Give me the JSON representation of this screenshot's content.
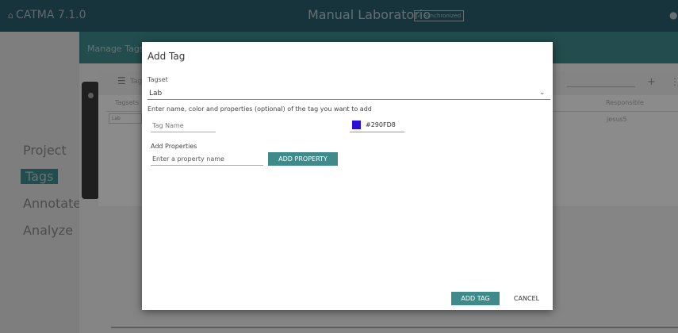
{
  "app": {
    "name": "CATMA 7.1.0",
    "logo_icon": "home-icon"
  },
  "document": {
    "title": "Manual Laboratorio",
    "sync_status": "Synchronized"
  },
  "sidebar": {
    "items": [
      {
        "label": "Project",
        "active": false
      },
      {
        "label": "Tags",
        "active": true
      },
      {
        "label": "Annotate",
        "active": false
      },
      {
        "label": "Analyze",
        "active": false
      }
    ]
  },
  "manage": {
    "title": "Manage Tags",
    "tab_label": "Tags",
    "columns": {
      "tagsets": "Tagsets",
      "responsible": "Responsible"
    },
    "rows": [
      {
        "tagset": "Lab",
        "responsible": "jesus5"
      }
    ]
  },
  "dialog": {
    "title": "Add Tag",
    "tagset_label": "Tagset",
    "tagset_value": "Lab",
    "instructions": "Enter name, color and properties (optional) of the tag you want to add",
    "tag_name_placeholder": "Tag Name",
    "color_hex": "#290FD8",
    "color_value": "#290FD8",
    "properties_label": "Add Properties",
    "property_placeholder": "Enter a property name",
    "add_property_label": "ADD PROPERTY",
    "add_tag_label": "ADD TAG",
    "cancel_label": "CANCEL"
  },
  "colors": {
    "accent": "#3f8b8c",
    "topbar": "#2a5e6e"
  }
}
